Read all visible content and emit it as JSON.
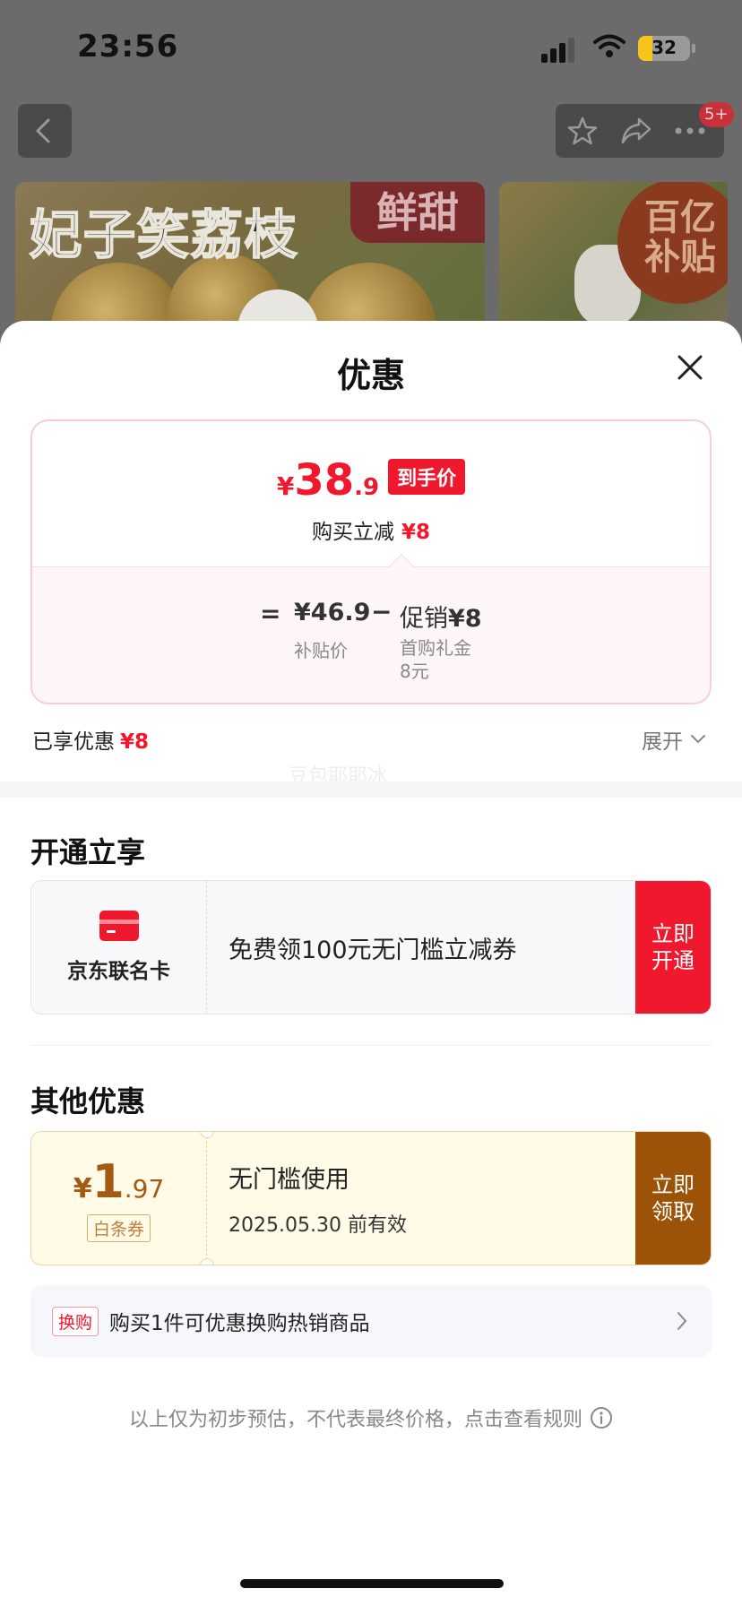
{
  "status_bar": {
    "time": "23:56",
    "battery": "32"
  },
  "background_page": {
    "notification_badge": "5+",
    "banner_left_title": "妃子笑荔枝",
    "banner_left_tag": "鲜甜",
    "banner_right_tag": "百亿补贴"
  },
  "sheet": {
    "title": "优惠",
    "final_price": {
      "currency": "¥",
      "integer": "38",
      "decimal": ".9",
      "tag": "到手价"
    },
    "reduce": {
      "label": "购买立减",
      "amount": "¥8"
    },
    "breakdown": {
      "equals": "=",
      "base_price": "¥46.9",
      "base_label": "补贴价",
      "minus": "−",
      "promo_label": "促销",
      "promo_amount": "¥8",
      "promo_detail": "首购礼金\n8元"
    },
    "enjoyed": {
      "label": "已享优惠",
      "amount": "¥8"
    },
    "expand_label": "展开",
    "watermark": "豆包耶耶冰",
    "open_section": {
      "title": "开通立享",
      "card_name": "京东联名卡",
      "offer": "免费领100元无门槛立减券",
      "button": "立即\n开通"
    },
    "other_section": {
      "title": "其他优惠",
      "coupon": {
        "currency": "¥",
        "integer": "1",
        "decimal": ".97",
        "tag": "白条券",
        "condition": "无门槛使用",
        "validity": "2025.05.30 前有效",
        "button": "立即\n领取"
      },
      "swap": {
        "tag": "换购",
        "text": "购买1件可优惠换购热销商品"
      }
    },
    "footnote": "以上仅为初步预估，不代表最终价格，点击查看规则"
  }
}
